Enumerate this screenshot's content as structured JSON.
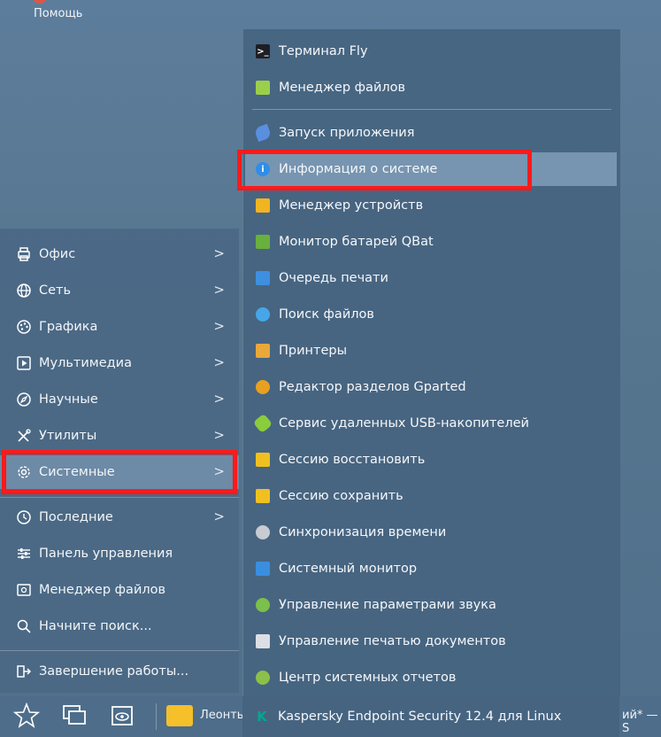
{
  "top": {
    "help_label": "Помощь"
  },
  "left_menu": {
    "items": [
      {
        "label": "Офис",
        "icon": "printer-outline-icon",
        "arrow": ">"
      },
      {
        "label": "Сеть",
        "icon": "globe-icon",
        "arrow": ">"
      },
      {
        "label": "Графика",
        "icon": "palette-icon",
        "arrow": ">"
      },
      {
        "label": "Мультимедиа",
        "icon": "play-icon",
        "arrow": ">"
      },
      {
        "label": "Научные",
        "icon": "compass-icon",
        "arrow": ">"
      },
      {
        "label": "Утилиты",
        "icon": "tools-icon",
        "arrow": ">"
      },
      {
        "label": "Системные",
        "icon": "gear-icon",
        "arrow": ">"
      },
      {
        "label": "Последние",
        "icon": "clock-icon",
        "arrow": ">"
      },
      {
        "label": "Панель управления",
        "icon": "sliders-icon"
      },
      {
        "label": "Менеджер файлов",
        "icon": "file-manager-icon"
      },
      {
        "label": "Начните поиск...",
        "icon": "search-icon"
      },
      {
        "label": "Завершение работы...",
        "icon": "logout-icon"
      }
    ]
  },
  "sub_menu": {
    "items": [
      {
        "label": "Терминал Fly",
        "icon": "terminal-icon",
        "color": "#1d1f24",
        "glyph": ">_"
      },
      {
        "label": "Менеджер файлов",
        "icon": "file-manager-icon",
        "color": "#9bcf4a",
        "glyph": ""
      },
      {
        "label": "Запуск приложения",
        "icon": "rocket-icon",
        "color": "#5a8fe0",
        "glyph": ""
      },
      {
        "label": "Информация о системе",
        "icon": "info-icon",
        "color": "#2f8ee6",
        "glyph": "i"
      },
      {
        "label": "Менеджер устройств",
        "icon": "device-manager-icon",
        "color": "#f0b520",
        "glyph": ""
      },
      {
        "label": "Монитор батарей QBat",
        "icon": "battery-icon",
        "color": "#6ab03c",
        "glyph": ""
      },
      {
        "label": "Очередь печати",
        "icon": "print-queue-icon",
        "color": "#3d8fe0",
        "glyph": ""
      },
      {
        "label": "Поиск файлов",
        "icon": "file-search-icon",
        "color": "#46a6e8",
        "glyph": ""
      },
      {
        "label": "Принтеры",
        "icon": "printer-icon",
        "color": "#e8a83a",
        "glyph": ""
      },
      {
        "label": "Редактор разделов Gparted",
        "icon": "gparted-icon",
        "color": "#e8a020",
        "glyph": ""
      },
      {
        "label": "Сервис удаленных USB-накопителей",
        "icon": "usb-icon",
        "color": "#8acc3c",
        "glyph": ""
      },
      {
        "label": "Сессию восстановить",
        "icon": "session-restore-icon",
        "color": "#f0c020",
        "glyph": ""
      },
      {
        "label": "Сессию сохранить",
        "icon": "session-save-icon",
        "color": "#f0c020",
        "glyph": ""
      },
      {
        "label": "Синхронизация времени",
        "icon": "time-sync-icon",
        "color": "#c8ccd2",
        "glyph": ""
      },
      {
        "label": "Системный монитор",
        "icon": "system-monitor-icon",
        "color": "#3a8ee0",
        "glyph": ""
      },
      {
        "label": "Управление параметрами звука",
        "icon": "sound-icon",
        "color": "#7ac04a",
        "glyph": ""
      },
      {
        "label": "Управление печатью документов",
        "icon": "print-manage-icon",
        "color": "#dcdfe4",
        "glyph": ""
      },
      {
        "label": "Центр системных отчетов",
        "icon": "reports-icon",
        "color": "#8cc04a",
        "glyph": ""
      },
      {
        "label": "Kaspersky Endpoint Security 12.4 для Linux",
        "icon": "kaspersky-icon",
        "color": "#00a88e",
        "glyph": "K"
      }
    ]
  },
  "taskbar": {
    "start_icon": "star-icon",
    "windows_icon": "windows-icon",
    "eye_icon": "eye-icon",
    "folder_icon": "folder-icon",
    "task_label": "Леонть",
    "right_label": "ий* — S"
  },
  "colors": {
    "highlight": "#ff1a1a"
  }
}
